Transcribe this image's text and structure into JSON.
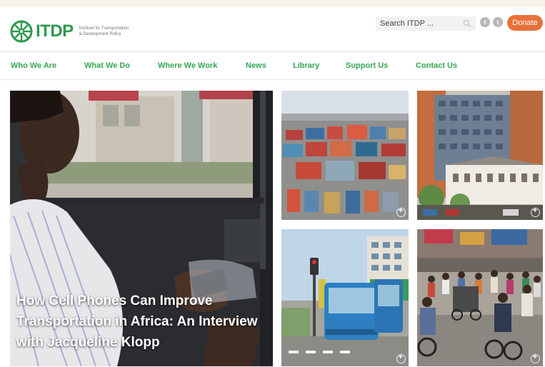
{
  "header": {
    "logo_text": "ITDP",
    "logo_sub_line1": "Institute for Transportation",
    "logo_sub_line2": "& Development Policy",
    "search_placeholder": "Search ITDP ...",
    "donate_label": "Donate",
    "social_1": "f",
    "social_2": "t"
  },
  "nav": {
    "items": [
      "Who We Are",
      "What We Do",
      "Where We Work",
      "News",
      "Library",
      "Support Us",
      "Contact Us"
    ]
  },
  "hero": {
    "title": "How Cell Phones Can Improve Transportation in Africa: An Interview with Jacqueline Klopp"
  },
  "colors": {
    "brand_green": "#34a853",
    "donate_orange": "#e8703a"
  }
}
